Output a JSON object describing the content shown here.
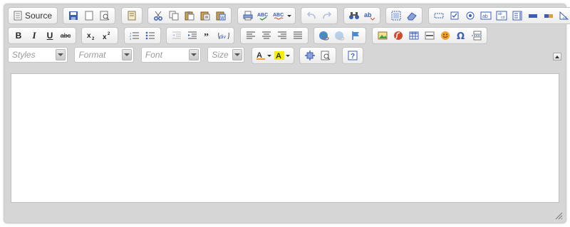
{
  "toolbar": {
    "source_label": "Source",
    "combos": {
      "styles": "Styles",
      "format": "Format",
      "font": "Font",
      "size": "Size"
    }
  },
  "colors": {
    "frame": "#d6d6d6",
    "icon_blue": "#3b5fb4",
    "icon_red": "#d24a2a"
  }
}
